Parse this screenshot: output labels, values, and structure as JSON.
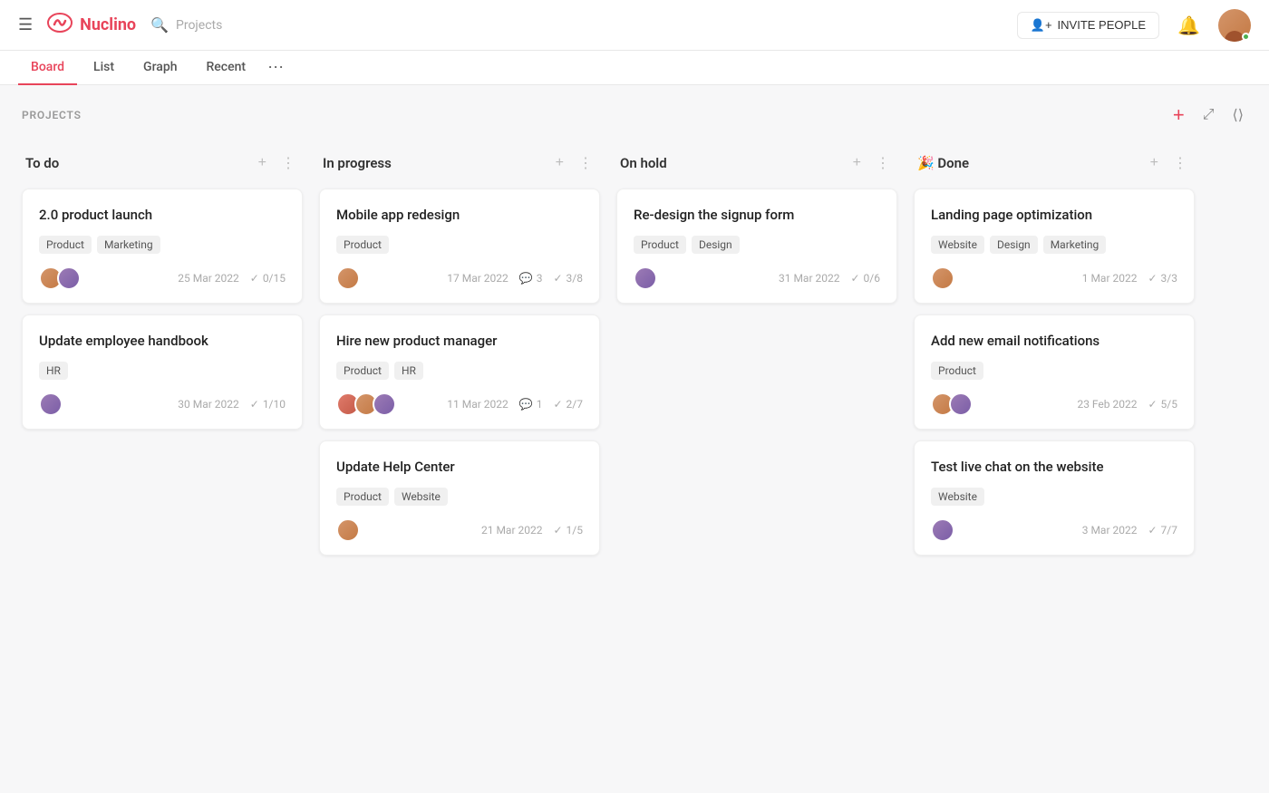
{
  "app": {
    "name": "Nuclino",
    "search_placeholder": "Projects"
  },
  "topbar": {
    "invite_label": "INVITE PEOPLE",
    "invite_icon": "person-add"
  },
  "tabs": [
    {
      "id": "board",
      "label": "Board",
      "active": true
    },
    {
      "id": "list",
      "label": "List",
      "active": false
    },
    {
      "id": "graph",
      "label": "Graph",
      "active": false
    },
    {
      "id": "recent",
      "label": "Recent",
      "active": false
    }
  ],
  "board": {
    "section_title": "PROJECTS",
    "columns": [
      {
        "id": "todo",
        "title": "To do",
        "cards": [
          {
            "id": "c1",
            "title": "2.0 product launch",
            "tags": [
              "Product",
              "Marketing"
            ],
            "avatars": [
              "a",
              "b"
            ],
            "date": "25 Mar 2022",
            "checks": "0/15",
            "comments": null
          },
          {
            "id": "c2",
            "title": "Update employee handbook",
            "tags": [
              "HR"
            ],
            "avatars": [
              "b"
            ],
            "date": "30 Mar 2022",
            "checks": "1/10",
            "comments": null
          }
        ]
      },
      {
        "id": "inprogress",
        "title": "In progress",
        "cards": [
          {
            "id": "c3",
            "title": "Mobile app redesign",
            "tags": [
              "Product"
            ],
            "avatars": [
              "a"
            ],
            "date": "17 Mar 2022",
            "checks": "3/8",
            "comments": "3"
          },
          {
            "id": "c4",
            "title": "Hire new product manager",
            "tags": [
              "Product",
              "HR"
            ],
            "avatars": [
              "c",
              "a",
              "b"
            ],
            "date": "11 Mar 2022",
            "checks": "2/7",
            "comments": "1"
          },
          {
            "id": "c5",
            "title": "Update Help Center",
            "tags": [
              "Product",
              "Website"
            ],
            "avatars": [
              "a"
            ],
            "date": "21 Mar 2022",
            "checks": "1/5",
            "comments": null
          }
        ]
      },
      {
        "id": "onhold",
        "title": "On hold",
        "cards": [
          {
            "id": "c6",
            "title": "Re-design the signup form",
            "tags": [
              "Product",
              "Design"
            ],
            "avatars": [
              "b"
            ],
            "date": "31 Mar 2022",
            "checks": "0/6",
            "comments": null
          }
        ]
      },
      {
        "id": "done",
        "title": "Done",
        "emoji": "🎉",
        "cards": [
          {
            "id": "c7",
            "title": "Landing page optimization",
            "tags": [
              "Website",
              "Design",
              "Marketing"
            ],
            "avatars": [
              "a"
            ],
            "date": "1 Mar 2022",
            "checks": "3/3",
            "comments": null
          },
          {
            "id": "c8",
            "title": "Add new email notifications",
            "tags": [
              "Product"
            ],
            "avatars": [
              "a",
              "b"
            ],
            "date": "23 Feb 2022",
            "checks": "5/5",
            "comments": null
          },
          {
            "id": "c9",
            "title": "Test live chat on the website",
            "tags": [
              "Website"
            ],
            "avatars": [
              "b"
            ],
            "date": "3 Mar 2022",
            "checks": "7/7",
            "comments": null
          }
        ]
      }
    ]
  }
}
